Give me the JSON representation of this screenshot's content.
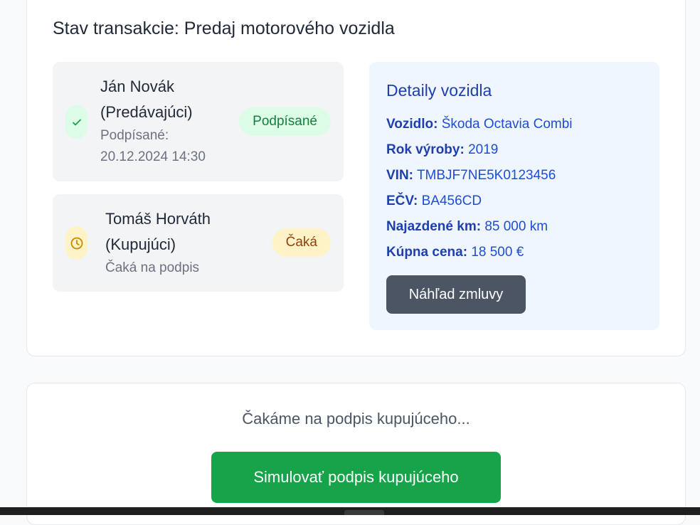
{
  "transaction": {
    "title": "Stav transakcie: Predaj motorového vozidla"
  },
  "parties": {
    "seller": {
      "name": "Ján Novák",
      "role": "(Predávajúci)",
      "signed_label": "Podpísané:",
      "signed_at": "20.12.2024 14:30",
      "badge": "Podpísané",
      "icon": "check-icon",
      "color": "#16a34a"
    },
    "buyer": {
      "name": "Tomáš Horváth",
      "role": "(Kupujúci)",
      "status_text": "Čaká na podpis",
      "badge": "Čaká",
      "icon": "clock-icon",
      "color": "#ca8a04"
    }
  },
  "vehicle": {
    "title": "Detaily vozidla",
    "rows": [
      {
        "label": "Vozidlo:",
        "value": "Škoda Octavia Combi"
      },
      {
        "label": "Rok výroby:",
        "value": "2019"
      },
      {
        "label": "VIN:",
        "value": "TMBJF7NE5K0123456"
      },
      {
        "label": "EČV:",
        "value": "BA456CD"
      },
      {
        "label": "Najazdené km:",
        "value": "85 000 km"
      },
      {
        "label": "Kúpna cena:",
        "value": "18 500 €"
      }
    ],
    "preview_button": "Náhľad zmluvy"
  },
  "waiting": {
    "message": "Čakáme na podpis kupujúceho...",
    "simulate_button": "Simulovať podpis kupujúceho"
  }
}
